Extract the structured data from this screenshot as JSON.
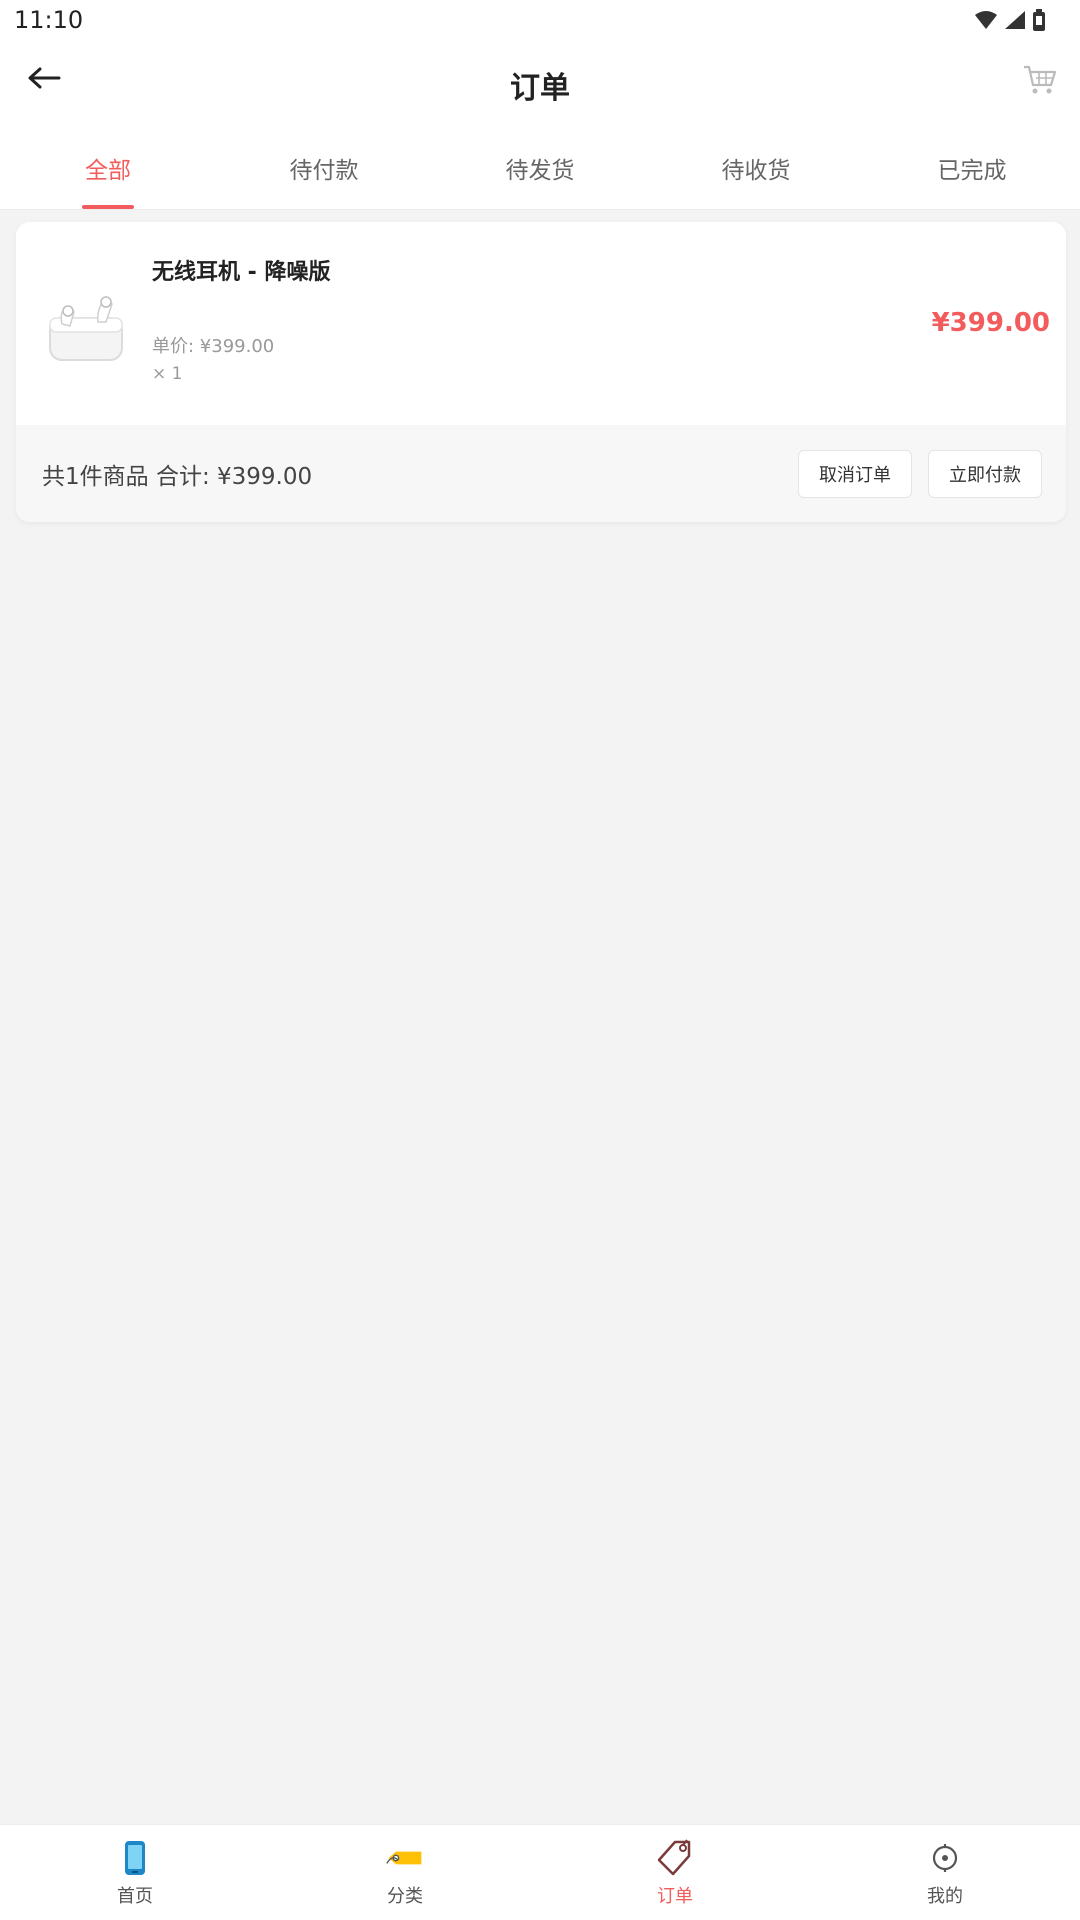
{
  "status_bar": {
    "time": "11:10"
  },
  "header": {
    "title": "订单",
    "back_icon": "back-arrow-icon",
    "cart_icon": "cart-icon"
  },
  "tabs": [
    {
      "label": "全部",
      "active": true
    },
    {
      "label": "待付款",
      "active": false
    },
    {
      "label": "待发货",
      "active": false
    },
    {
      "label": "待收货",
      "active": false
    },
    {
      "label": "已完成",
      "active": false
    }
  ],
  "order": {
    "product_name": "无线耳机 - 降噪版",
    "unit_price": "单价: ¥399.00",
    "quantity": "× 1",
    "item_total": "¥399.00",
    "summary": "共1件商品 合计: ¥399.00",
    "cancel_label": "取消订单",
    "pay_label": "立即付款"
  },
  "bottom_nav": [
    {
      "label": "首页",
      "icon": "phone-icon",
      "active": false
    },
    {
      "label": "分类",
      "icon": "tag-icon",
      "active": false
    },
    {
      "label": "订单",
      "icon": "order-tag-icon",
      "active": true
    },
    {
      "label": "我的",
      "icon": "profile-icon",
      "active": false
    }
  ],
  "colors": {
    "accent": "#f25c5c",
    "background": "#f3f3f3"
  }
}
